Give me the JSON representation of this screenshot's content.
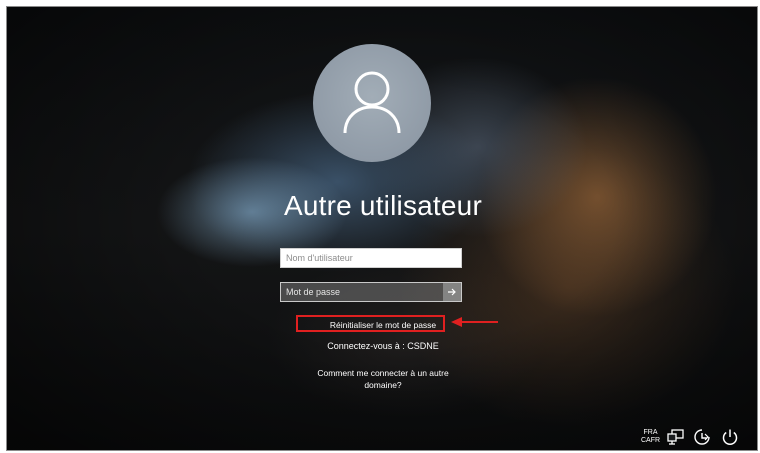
{
  "user": {
    "name": "Autre utilisateur"
  },
  "form": {
    "username_placeholder": "Nom d'utilisateur",
    "password_placeholder": "Mot de passe"
  },
  "links": {
    "reset_password": "Réinitialiser le mot de passe",
    "connect_to": "Connectez-vous à : CSDNE",
    "other_domain": "Comment me connecter à un autre domaine?"
  },
  "tray": {
    "language_line1": "FRA",
    "language_line2": "CAFR",
    "icons": [
      "network-icon",
      "accessibility-icon",
      "power-icon"
    ]
  },
  "colors": {
    "highlight": "#e02020",
    "text": "#ffffff"
  }
}
